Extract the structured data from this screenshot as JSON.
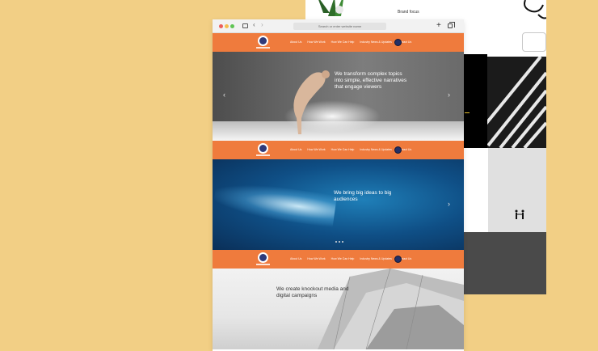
{
  "background_page": {
    "brand_focus": "Brand focus"
  },
  "browser": {
    "url_placeholder": "Search or enter website name",
    "new_tab": "+"
  },
  "nav": {
    "links": [
      "About Us",
      "How We Work",
      "How We Can Help",
      "Industry News & Updates",
      "Contact Us"
    ]
  },
  "heroes": {
    "hero1_heading": "We transform complex topics into simple, effective narratives that engage viewers",
    "hero2_heading": "We bring big ideas to big audiences",
    "hero3_heading": "We create knockout media and digital campaigns"
  },
  "colors": {
    "background": "#f2cf85",
    "nav_orange": "#ef7b3d",
    "logo_navy": "#2f3a7a"
  }
}
